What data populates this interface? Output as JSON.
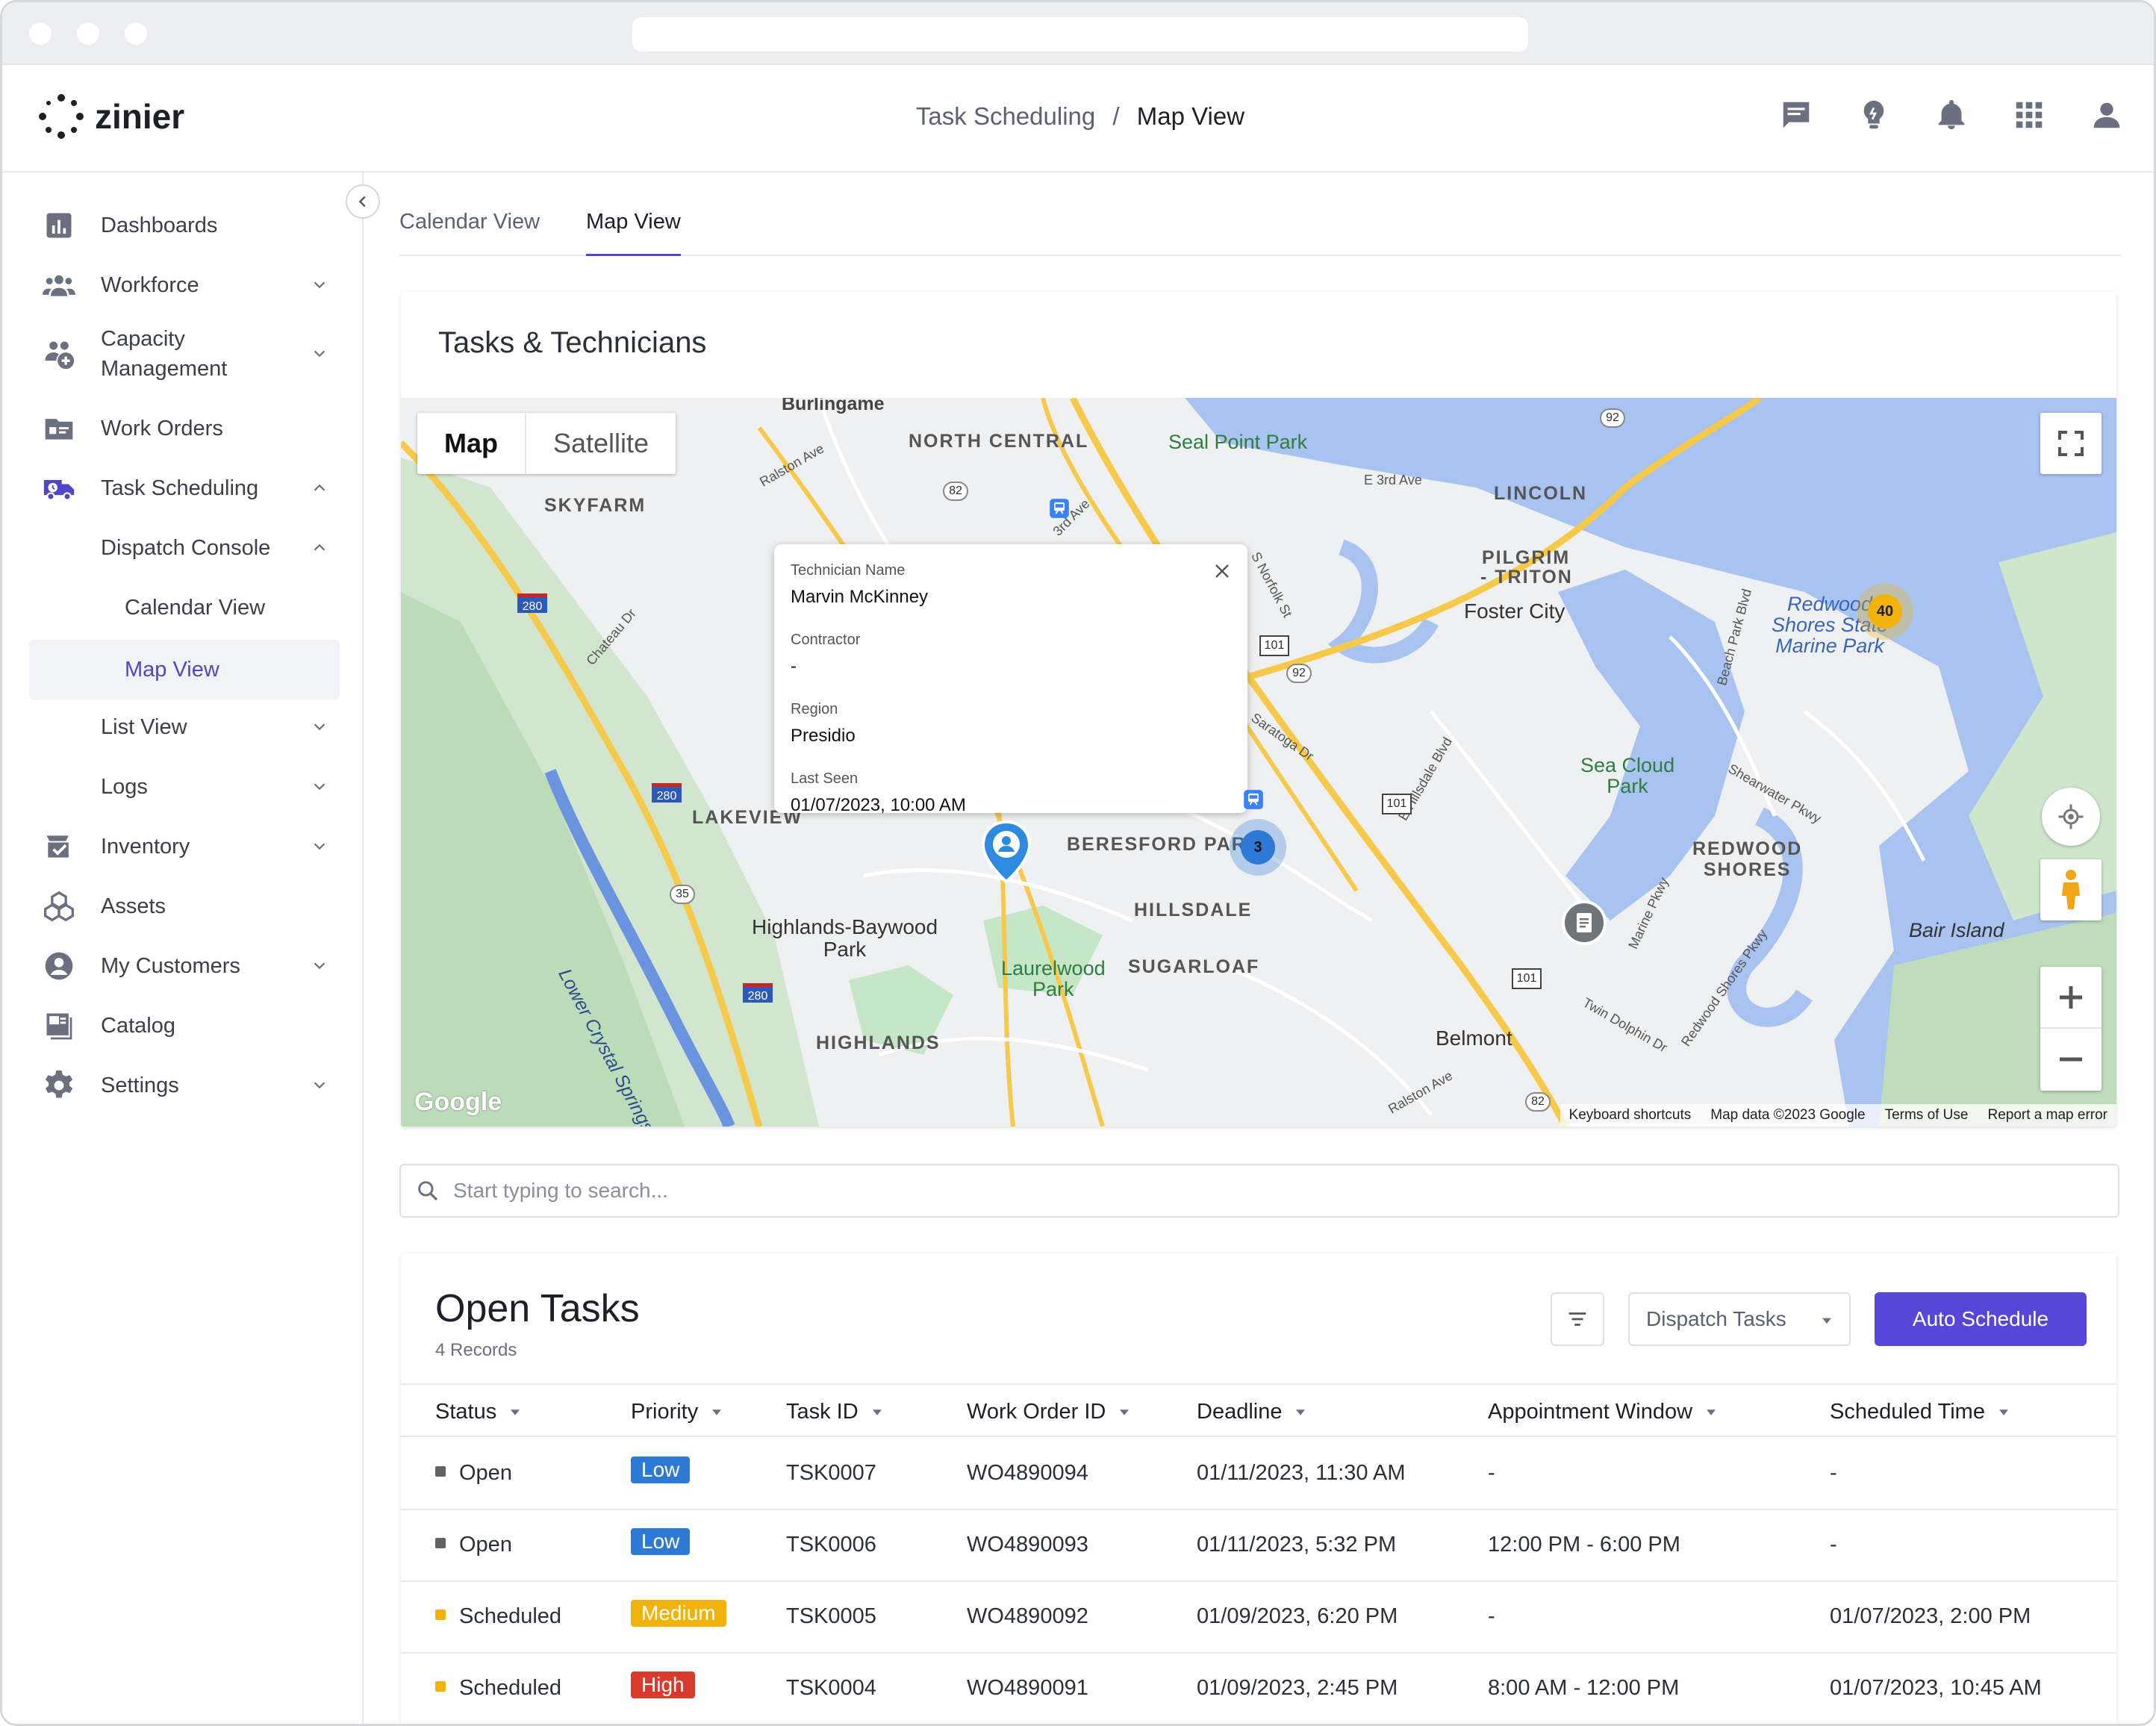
{
  "app": {
    "logo_text": "zinier",
    "breadcrumb_parent": "Task Scheduling",
    "breadcrumb_separator": "/",
    "breadcrumb_current": "Map View"
  },
  "header_icons": [
    "chat-icon",
    "lightbulb-icon",
    "bell-icon",
    "apps-grid-icon",
    "user-icon"
  ],
  "sidebar": {
    "items": [
      {
        "label": "Dashboards",
        "icon": "bar-chart-icon"
      },
      {
        "label": "Workforce",
        "icon": "people-icon",
        "chevron": "down"
      },
      {
        "label": "Capacity",
        "label2": "Management",
        "icon": "capacity-icon",
        "chevron": "down"
      },
      {
        "label": "Work Orders",
        "icon": "folder-icon"
      },
      {
        "label": "Task Scheduling",
        "icon": "truck-clock-icon",
        "chevron": "up"
      },
      {
        "label": "Dispatch Console",
        "chevron": "up"
      },
      {
        "label": "Calendar View"
      },
      {
        "label": "Map View"
      },
      {
        "label": "List View",
        "chevron": "down"
      },
      {
        "label": "Logs",
        "chevron": "down"
      },
      {
        "label": "Inventory",
        "icon": "inventory-icon",
        "chevron": "down"
      },
      {
        "label": "Assets",
        "icon": "cubes-icon"
      },
      {
        "label": "My Customers",
        "icon": "account-icon",
        "chevron": "down"
      },
      {
        "label": "Catalog",
        "icon": "catalog-icon"
      },
      {
        "label": "Settings",
        "icon": "gear-icon",
        "chevron": "down"
      }
    ]
  },
  "tabs": [
    {
      "label": "Calendar View",
      "active": false
    },
    {
      "label": "Map View",
      "active": true
    }
  ],
  "map_card": {
    "title": "Tasks & Technicians",
    "map_type_buttons": [
      "Map",
      "Satellite"
    ],
    "popup": {
      "technician_label": "Technician Name",
      "technician_value": "Marvin McKinney",
      "contractor_label": "Contractor",
      "contractor_value": "-",
      "region_label": "Region",
      "region_value": "Presidio",
      "last_seen_label": "Last Seen",
      "last_seen_value": "01/07/2023, 10:00 AM"
    },
    "clusters": {
      "orange": "40",
      "blue": "3"
    },
    "map_labels": [
      "Burlingame",
      "NORTH CENTRAL",
      "Seal Point Park",
      "LINCOLN",
      "SKYFARM",
      "PILGRIM",
      "- TRITON",
      "Foster City",
      "Redwood",
      "Shores State",
      "Marine Park",
      "LAKEVIEW",
      "BERESFORD PARK",
      "HILLSDALE",
      "Sea Cloud",
      "Park",
      "REDWOOD",
      "SHORES",
      "Highlands-Baywood",
      "Park",
      "Laurelwood",
      "Park",
      "SUGARLOAF",
      "Bair Island",
      "HIGHLANDS",
      "Belmont",
      "Lower Crystal Springs Reservoir",
      "Google"
    ],
    "road_labels": [
      "E 3rd Ave",
      "Ralston Ave",
      "Chateau Dr",
      "S Norfolk St",
      "E Hillsdale Blvd",
      "Saratoga Dr",
      "Beach Park Blvd",
      "Shearwater Pkwy",
      "Marine Pkwy",
      "Redwood Shores Pkwy",
      "Twin Dolphin Dr",
      "Ralston Ave",
      "3rd Ave"
    ],
    "shields": [
      "92",
      "82",
      "280",
      "101",
      "92",
      "280",
      "35",
      "280",
      "101",
      "101",
      "92",
      "82"
    ],
    "attribution": [
      "Keyboard shortcuts",
      "Map data ©2023 Google",
      "Terms of Use",
      "Report a map error"
    ]
  },
  "search": {
    "placeholder": "Start typing to search..."
  },
  "open_tasks": {
    "title": "Open Tasks",
    "records": "4 Records",
    "dispatch_select": "Dispatch Tasks",
    "auto_schedule": "Auto Schedule",
    "columns": [
      "Status",
      "Priority",
      "Task ID",
      "Work Order ID",
      "Deadline",
      "Appointment Window",
      "Scheduled Time"
    ],
    "rows": [
      {
        "status": "Open",
        "priority": "Low",
        "task_id": "TSK0007",
        "wo_id": "WO4890094",
        "deadline": "01/11/2023, 11:30 AM",
        "window": "-",
        "scheduled": "-"
      },
      {
        "status": "Open",
        "priority": "Low",
        "task_id": "TSK0006",
        "wo_id": "WO4890093",
        "deadline": "01/11/2023, 5:32 PM",
        "window": "12:00 PM - 6:00 PM",
        "scheduled": "-"
      },
      {
        "status": "Scheduled",
        "priority": "Medium",
        "task_id": "TSK0005",
        "wo_id": "WO4890092",
        "deadline": "01/09/2023, 6:20 PM",
        "window": "-",
        "scheduled": "01/07/2023, 2:00 PM"
      },
      {
        "status": "Scheduled",
        "priority": "High",
        "task_id": "TSK0004",
        "wo_id": "WO4890091",
        "deadline": "01/09/2023, 2:45 PM",
        "window": "8:00 AM - 12:00 PM",
        "scheduled": "01/07/2023, 10:45 AM"
      }
    ]
  },
  "colors": {
    "accent": "#5548d9",
    "status_open": "#5f6368",
    "status_scheduled": "#f2b20c",
    "priority_low": "#2d7ad6",
    "priority_medium": "#f2b20c",
    "priority_high": "#d93a2b",
    "water": "#a8c3f0",
    "park": "#c6e6c8",
    "road": "#f7c94b"
  }
}
